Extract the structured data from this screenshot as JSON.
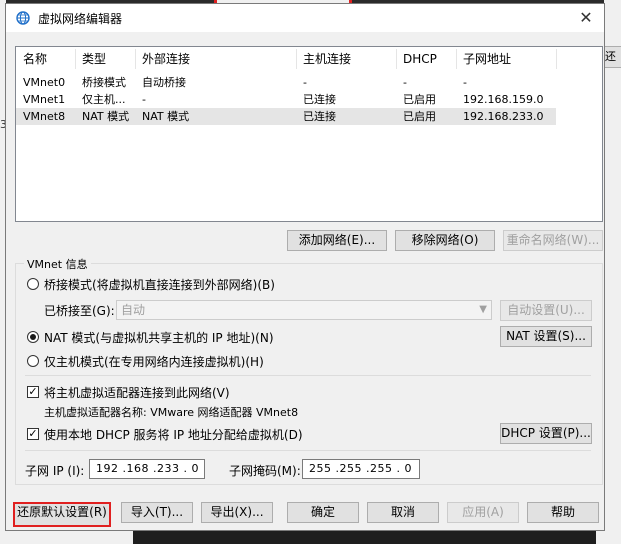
{
  "background": {
    "right_button_text": "还",
    "left_mark": "3"
  },
  "dialog": {
    "title": "虚拟网络编辑器",
    "close_glyph": "✕"
  },
  "networks": {
    "columns": [
      "名称",
      "类型",
      "外部连接",
      "主机连接",
      "DHCP",
      "子网地址"
    ],
    "rows": [
      {
        "name": "VMnet0",
        "type": "桥接模式",
        "external": "自动桥接",
        "host": "-",
        "dhcp": "-",
        "subnet": "-"
      },
      {
        "name": "VMnet1",
        "type": "仅主机...",
        "external": "-",
        "host": "已连接",
        "dhcp": "已启用",
        "subnet": "192.168.159.0"
      },
      {
        "name": "VMnet8",
        "type": "NAT 模式",
        "external": "NAT 模式",
        "host": "已连接",
        "dhcp": "已启用",
        "subnet": "192.168.233.0"
      }
    ],
    "selected_index": 2
  },
  "list_buttons": {
    "add": "添加网络(E)...",
    "remove": "移除网络(O)",
    "rename": "重命名网络(W)..."
  },
  "vmnet_info": {
    "group_title": "VMnet 信息",
    "bridged_label": "桥接模式(将虚拟机直接连接到外部网络)(B)",
    "bridged_to_label": "已桥接至(G):",
    "bridged_to_value": "自动",
    "auto_settings": "自动设置(U)...",
    "nat_label": "NAT 模式(与虚拟机共享主机的 IP 地址)(N)",
    "nat_settings": "NAT 设置(S)...",
    "host_only_label": "仅主机模式(在专用网络内连接虚拟机)(H)",
    "connect_adapter_label": "将主机虚拟适配器连接到此网络(V)",
    "adapter_name_line": "主机虚拟适配器名称: VMware 网络适配器 VMnet8",
    "dhcp_label": "使用本地 DHCP 服务将 IP 地址分配给虚拟机(D)",
    "dhcp_settings": "DHCP 设置(P)...",
    "subnet_ip_label": "子网 IP (I):",
    "subnet_ip_value": "192 .168 .233 .  0",
    "subnet_mask_label": "子网掩码(M):",
    "subnet_mask_value": "255 .255 .255 .  0",
    "selected_mode": "nat",
    "connect_adapter_checked": true,
    "dhcp_checked": true
  },
  "footer": {
    "restore": "还原默认设置(R)",
    "import": "导入(T)...",
    "export": "导出(X)...",
    "ok": "确定",
    "cancel": "取消",
    "apply": "应用(A)",
    "help": "帮助"
  },
  "colors": {
    "highlight_border": "#e02020",
    "selected_row": "#e5e5e5",
    "dialog_bg": "#f0f0f0"
  }
}
